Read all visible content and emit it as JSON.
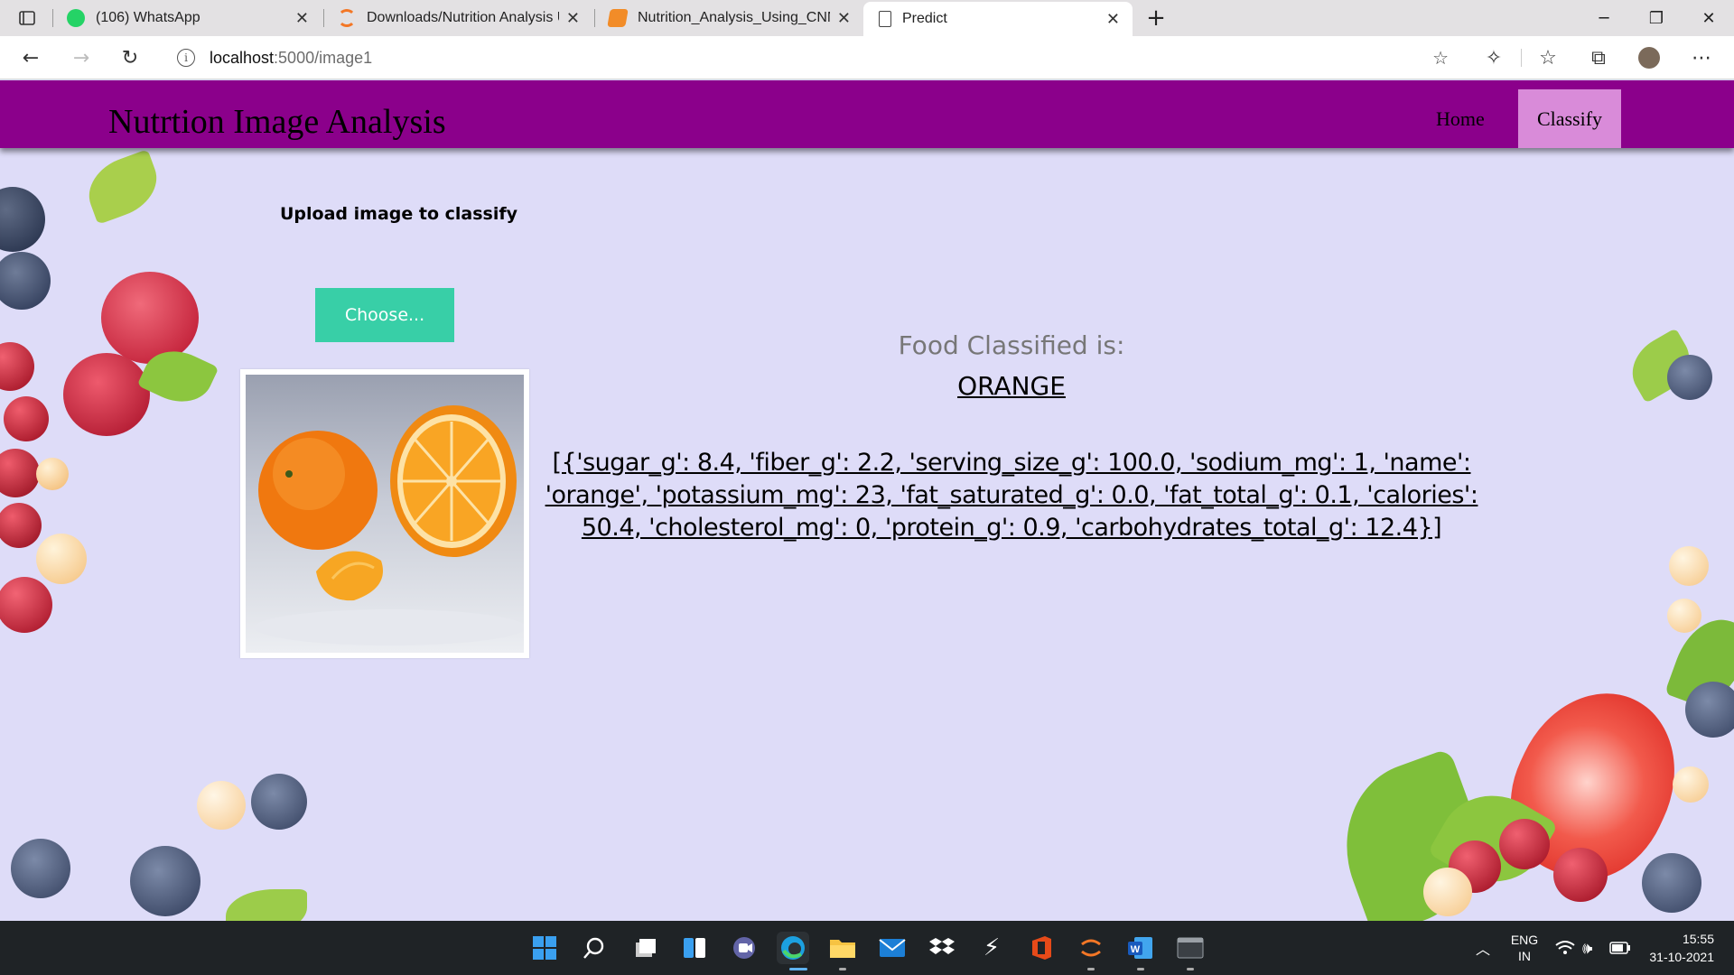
{
  "browser": {
    "tabs": [
      {
        "title": "(106) WhatsApp",
        "favicon": "whatsapp-icon",
        "active": false
      },
      {
        "title": "Downloads/Nutrition Analysis Us",
        "favicon": "jupyter-icon",
        "active": false
      },
      {
        "title": "Nutrition_Analysis_Using_CNN -",
        "favicon": "notebook-icon",
        "active": false
      },
      {
        "title": "Predict",
        "favicon": "page-icon",
        "active": true
      }
    ],
    "address": {
      "host": "localhost",
      "path": ":5000/image1"
    }
  },
  "page": {
    "brand": "Nutrtion Image Analysis",
    "nav": {
      "home": "Home",
      "classify": "Classify"
    },
    "upload_title": "Upload image to classify",
    "choose_label": "Choose...",
    "result_label": "Food Classified is:",
    "result_class": "ORANGE",
    "result_json": "[{'sugar_g': 8.4, 'fiber_g': 2.2, 'serving_size_g': 100.0, 'sodium_mg': 1, 'name': 'orange', 'potassium_mg': 23, 'fat_saturated_g': 0.0, 'fat_total_g': 0.1, 'calories': 50.4, 'cholesterol_mg': 0, 'protein_g': 0.9, 'carbohydrates_total_g': 12.4}]"
  },
  "colors": {
    "header": "#8b008b",
    "classify_active": "#d98bd9",
    "choose_button": "#38cfa7",
    "page_background": "#dedcf8"
  },
  "taskbar": {
    "language": "ENG",
    "region": "IN",
    "time": "15:55",
    "date": "31-10-2021",
    "apps": [
      "start-icon",
      "search-icon",
      "task-view-icon",
      "widgets-icon",
      "teams-chat-icon",
      "edge-icon",
      "file-explorer-icon",
      "mail-icon",
      "dropbox-icon",
      "app-icon",
      "office-icon",
      "jupyter-icon",
      "word-icon",
      "terminal-icon"
    ]
  }
}
